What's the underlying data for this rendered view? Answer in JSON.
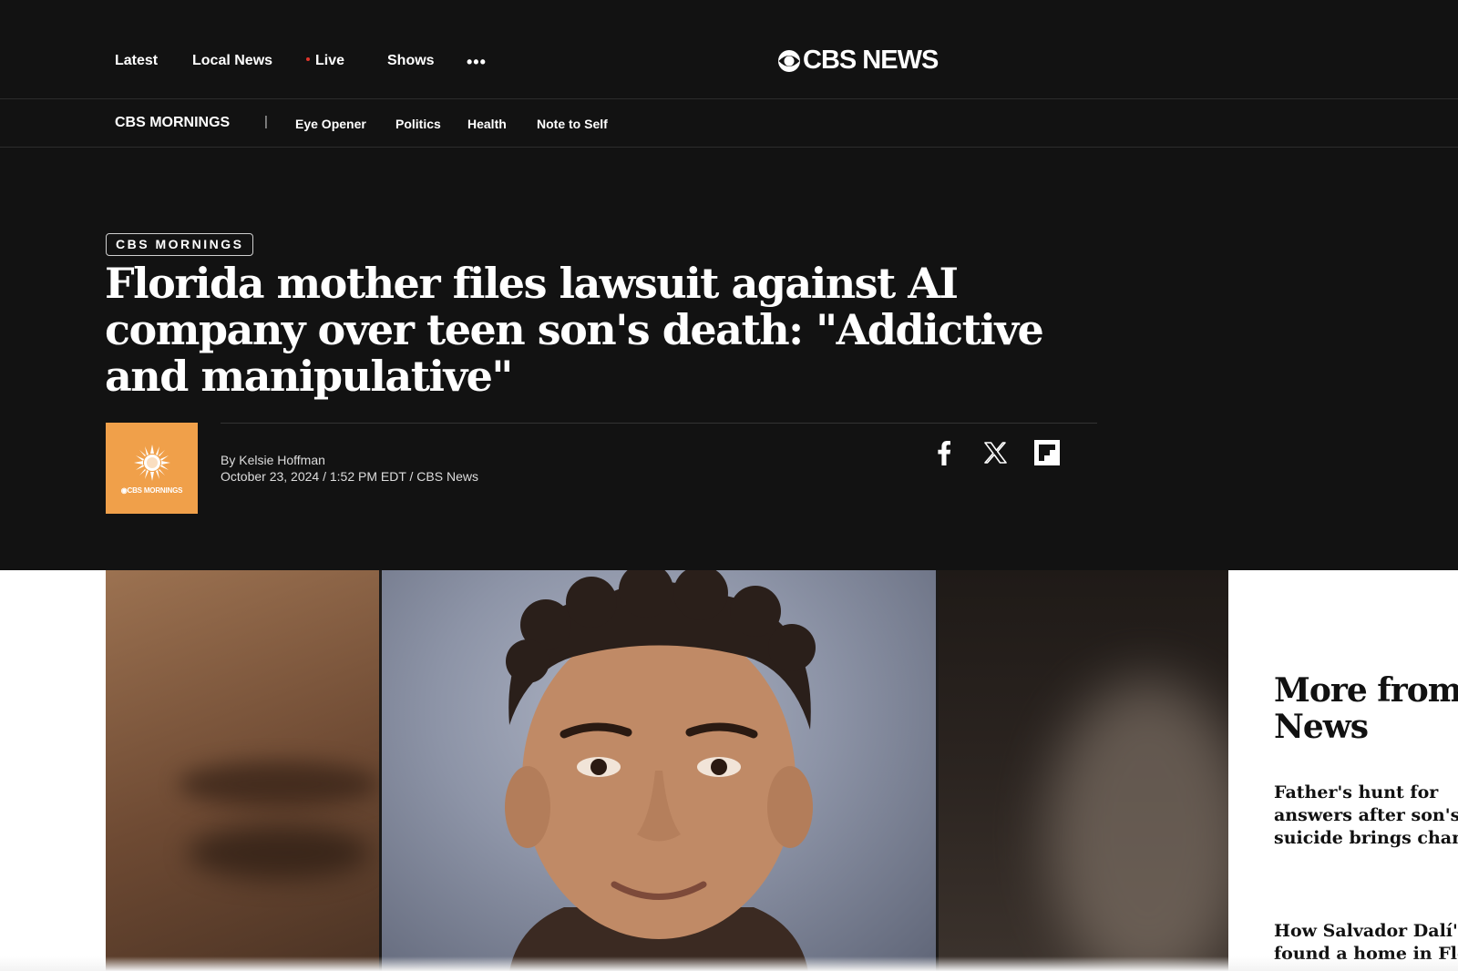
{
  "topnav": {
    "items": [
      {
        "label": "Latest"
      },
      {
        "label": "Local News"
      },
      {
        "label": "Live"
      },
      {
        "label": "Shows"
      }
    ],
    "more_label": "•••",
    "logo_text": "CBS NEWS"
  },
  "subnav": {
    "brand": "CBS MORNINGS",
    "separator": "|",
    "items": [
      {
        "label": "Eye Opener"
      },
      {
        "label": "Politics"
      },
      {
        "label": "Health"
      },
      {
        "label": "Note to Self"
      }
    ]
  },
  "article": {
    "eyebrow": "CBS MORNINGS",
    "headline": "Florida mother files lawsuit against AI company over teen son's death: \"Addictive and manipulative\"",
    "author_line": "By Kelsie Hoffman",
    "date_line": "October 23, 2024 / 1:52 PM EDT / CBS News",
    "avatar_text": "CBS MORNINGS",
    "share_icons": [
      "facebook-icon",
      "x-icon",
      "flipboard-icon"
    ]
  },
  "sidebar": {
    "title_line1": "More from",
    "title_line2": "News",
    "links": [
      {
        "line1": "Father's hunt for",
        "line2": "answers after son's",
        "line3": "suicide brings chang"
      },
      {
        "line1": "How Salvador Dalí's",
        "line2": "found a home in Flor"
      }
    ]
  },
  "colors": {
    "header_bg": "#121212",
    "live_dot": "#e0352b",
    "avatar_bg": "#f0a04a"
  }
}
